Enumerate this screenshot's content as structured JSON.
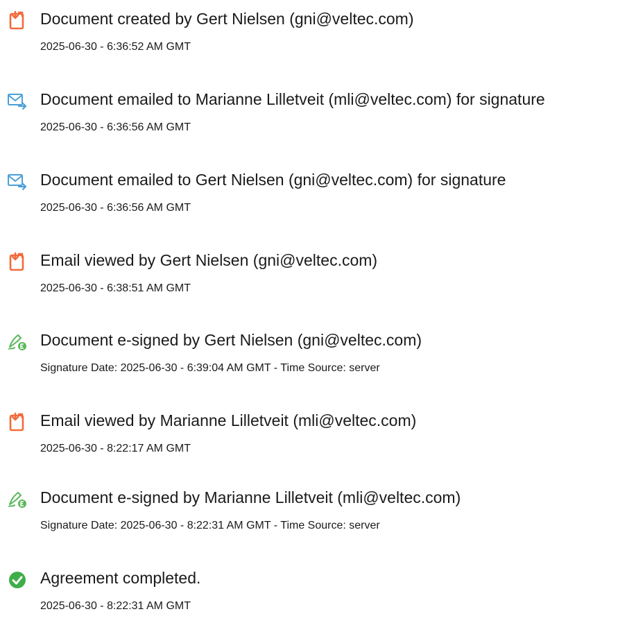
{
  "entries": [
    {
      "icon": "document-created-icon",
      "title": "Document created by Gert Nielsen (gni@veltec.com)",
      "subtitle": "2025-06-30 - 6:36:52 AM GMT"
    },
    {
      "icon": "document-emailed-icon",
      "title": "Document emailed to Marianne Lilletveit (mli@veltec.com) for signature",
      "subtitle": "2025-06-30 - 6:36:56 AM GMT"
    },
    {
      "icon": "document-emailed-icon",
      "title": "Document emailed to Gert Nielsen (gni@veltec.com) for signature",
      "subtitle": "2025-06-30 - 6:36:56 AM GMT"
    },
    {
      "icon": "email-viewed-icon",
      "title": "Email viewed by Gert Nielsen (gni@veltec.com)",
      "subtitle": "2025-06-30 - 6:38:51 AM GMT"
    },
    {
      "icon": "e-signed-icon",
      "title": "Document e-signed by Gert Nielsen (gni@veltec.com)",
      "subtitle": "Signature Date: 2025-06-30 - 6:39:04 AM GMT - Time Source: server"
    },
    {
      "icon": "email-viewed-icon",
      "title": "Email viewed by Marianne Lilletveit (mli@veltec.com)",
      "subtitle": "2025-06-30 - 8:22:17 AM GMT"
    },
    {
      "icon": "e-signed-icon",
      "title": "Document e-signed by Marianne Lilletveit (mli@veltec.com)",
      "subtitle": "Signature Date: 2025-06-30 - 8:22:31 AM GMT - Time Source: server"
    },
    {
      "icon": "agreement-completed-icon",
      "title": "Agreement completed.",
      "subtitle": "2025-06-30 - 8:22:31 AM GMT"
    }
  ],
  "colors": {
    "doc_orange": "#f26b3a",
    "mail_blue": "#4a9fd8",
    "sign_green": "#5cb85c",
    "check_green": "#3fae49",
    "text": "#1a1a1a"
  }
}
